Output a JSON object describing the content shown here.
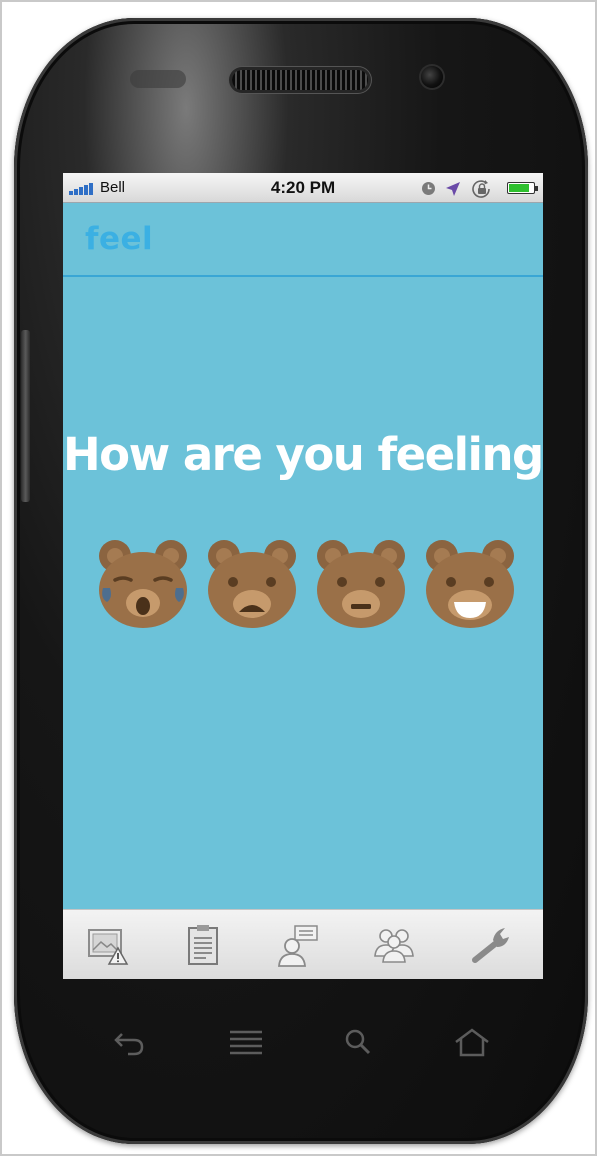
{
  "status_bar": {
    "carrier": "Bell",
    "time": "4:20 PM",
    "battery_level": 0.85,
    "icons": [
      "signal-bars-icon",
      "clock-icon",
      "location-arrow-icon",
      "rotation-lock-icon",
      "battery-icon"
    ]
  },
  "app": {
    "title": "feel",
    "accent_color": "#3bb0e3",
    "background_color": "#6cc2d9"
  },
  "mood_prompt": {
    "question": "How are you feeling?",
    "options": [
      {
        "name": "crying-bear-icon"
      },
      {
        "name": "sad-bear-icon"
      },
      {
        "name": "neutral-bear-icon"
      },
      {
        "name": "happy-bear-icon"
      }
    ]
  },
  "tab_bar": {
    "tabs": [
      {
        "name": "photo-warning-icon"
      },
      {
        "name": "clipboard-icon"
      },
      {
        "name": "profile-messages-icon"
      },
      {
        "name": "people-group-icon"
      },
      {
        "name": "wrench-icon"
      }
    ]
  },
  "device_keys": [
    "back-icon",
    "menu-icon",
    "search-icon",
    "home-icon"
  ]
}
